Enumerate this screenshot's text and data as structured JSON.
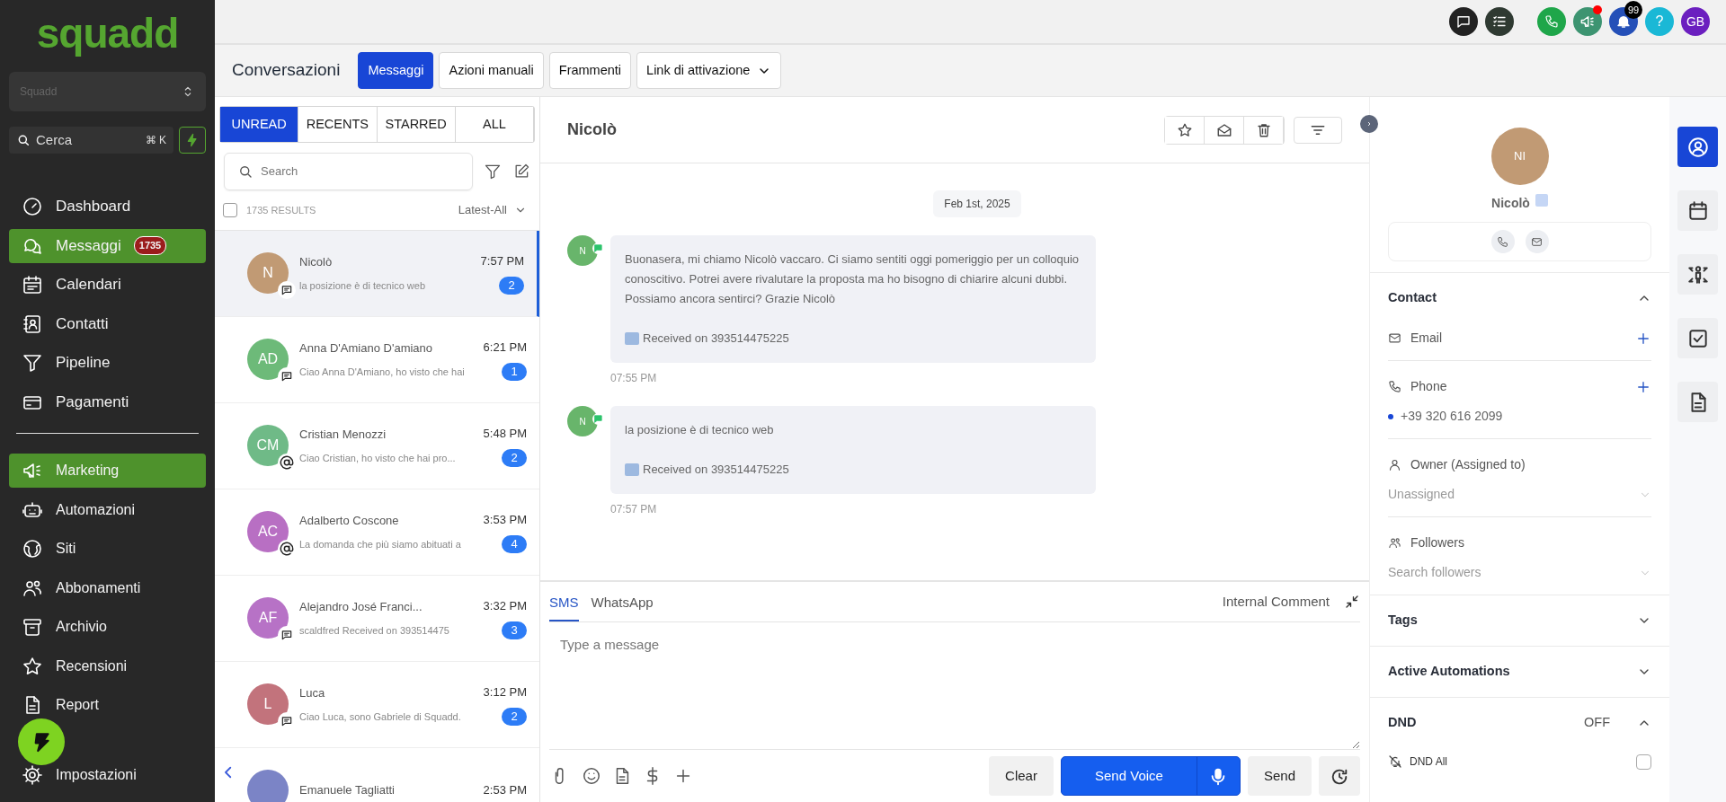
{
  "top_bar": {
    "announcement_unread": true,
    "notification_count": "99",
    "help_label": "?",
    "user_initials": "GB"
  },
  "sidebar": {
    "logo": "squadd",
    "account": "Squadd",
    "search_placeholder": "Cerca",
    "shortcut": "⌘ K",
    "groups": [
      {
        "items": [
          {
            "label": "Dashboard",
            "selected": false
          },
          {
            "label": "Messaggi",
            "badge": "1735",
            "selected": true
          },
          {
            "label": "Calendari",
            "selected": false
          },
          {
            "label": "Contatti",
            "selected": false
          },
          {
            "label": "Pipeline",
            "selected": false
          },
          {
            "label": "Pagamenti",
            "selected": false
          }
        ]
      },
      {
        "items": [
          {
            "label": "Marketing",
            "selected": true
          },
          {
            "label": "Automazioni",
            "selected": false
          },
          {
            "label": "Siti",
            "selected": false
          },
          {
            "label": "Abbonamenti",
            "selected": false
          },
          {
            "label": "Archivio",
            "selected": false
          },
          {
            "label": "Recensioni",
            "selected": false
          },
          {
            "label": "Report",
            "selected": false
          }
        ]
      }
    ],
    "footer_item": "Impostazioni"
  },
  "header": {
    "title": "Conversazioni",
    "tabs": [
      {
        "label": "Messaggi",
        "selected": true
      },
      {
        "label": "Azioni manuali",
        "selected": false
      },
      {
        "label": "Frammenti",
        "selected": false
      },
      {
        "label": "Link di attivazione",
        "selected": false,
        "dropdown": true
      }
    ]
  },
  "list": {
    "filters": [
      {
        "label": "UNREAD",
        "selected": true
      },
      {
        "label": "RECENTS",
        "selected": false
      },
      {
        "label": "STARRED",
        "selected": false
      },
      {
        "label": "ALL",
        "selected": false
      }
    ],
    "search_placeholder": "Search",
    "select_all": false,
    "results": "1735 RESULTS",
    "sort": "Latest-All",
    "conversations": [
      {
        "initials": "N",
        "color": "#c19a74",
        "name": "Nicolò",
        "preview": "la posizione è di tecnico web",
        "time": "7:57 PM",
        "unread": "2",
        "kind": "sms",
        "selected": true
      },
      {
        "initials": "AD",
        "color": "#6dba79",
        "name": "Anna D'Amiano D'amiano",
        "preview": "Ciao Anna D'Amiano, ho visto che hai",
        "time": "6:21 PM",
        "unread": "1",
        "kind": "sms",
        "selected": false
      },
      {
        "initials": "CM",
        "color": "#6fba87",
        "name": "Cristian Menozzi",
        "preview": "Ciao Cristian, ho visto che hai pro...",
        "time": "5:48 PM",
        "unread": "2",
        "kind": "email",
        "selected": false
      },
      {
        "initials": "AC",
        "color": "#b86fc3",
        "name": "Adalberto Coscone",
        "preview": "La domanda che più siamo abituati a",
        "time": "3:53 PM",
        "unread": "4",
        "kind": "email",
        "selected": false
      },
      {
        "initials": "AF",
        "color": "#b772c6",
        "name": "Alejandro José Franci...",
        "preview": "scaldfred Received on 393514475",
        "time": "3:32 PM",
        "unread": "3",
        "kind": "sms",
        "selected": false
      },
      {
        "initials": "L",
        "color": "#c2737c",
        "name": "Luca",
        "preview": "Ciao Luca, sono Gabriele di Squadd.",
        "time": "3:12 PM",
        "unread": "2",
        "kind": "sms",
        "selected": false
      },
      {
        "color": "#7b84c6",
        "name": "Emanuele Tagliatti",
        "time": "2:53 PM",
        "selected": false
      }
    ]
  },
  "chat": {
    "contact_name": "Nicolò",
    "date": "Feb 1st, 2025",
    "messages": [
      {
        "initials": "N",
        "text": "Buonasera, mi chiamo Nicolò vaccaro. Ci siamo sentiti oggi pomeriggio per un colloquio conoscitivo. Potrei avere rivalutare la proposta ma ho bisogno di chiarire alcuni dubbi.  Possiamo ancora sentirci? Grazie Nicolò",
        "received": "Received on 393514475225",
        "time": "07:55 PM"
      },
      {
        "initials": "N",
        "text": "la posizione è di tecnico web",
        "received": "Received on 393514475225",
        "time": "07:57 PM"
      }
    ],
    "composer": {
      "channels": [
        {
          "label": "SMS",
          "selected": true
        },
        {
          "label": "WhatsApp",
          "selected": false
        }
      ],
      "internal_comment": "Internal Comment",
      "placeholder": "Type a message",
      "clear": "Clear",
      "send_voice": "Send Voice",
      "send": "Send"
    }
  },
  "contact": {
    "initials": "NI",
    "name": "Nicolò",
    "sections": [
      {
        "title": "Contact",
        "expanded": true,
        "fields": [
          {
            "kind": "add",
            "label": "Email"
          },
          {
            "kind": "add",
            "label": "Phone",
            "value": "+39 320 616 2099"
          },
          {
            "kind": "select",
            "label": "Owner (Assigned to)",
            "value": "Unassigned"
          },
          {
            "kind": "select",
            "label": "Followers",
            "placeholder": "Search followers"
          }
        ]
      },
      {
        "title": "Tags",
        "expanded": false
      },
      {
        "title": "Active Automations",
        "expanded": false
      },
      {
        "title": "DND",
        "expanded": true,
        "status": "OFF",
        "options": [
          {
            "label": "DND All",
            "checked": false
          }
        ]
      }
    ]
  },
  "rail": [
    {
      "selected": true
    },
    {
      "selected": false
    },
    {
      "selected": false
    },
    {
      "selected": false
    },
    {
      "selected": false
    }
  ]
}
